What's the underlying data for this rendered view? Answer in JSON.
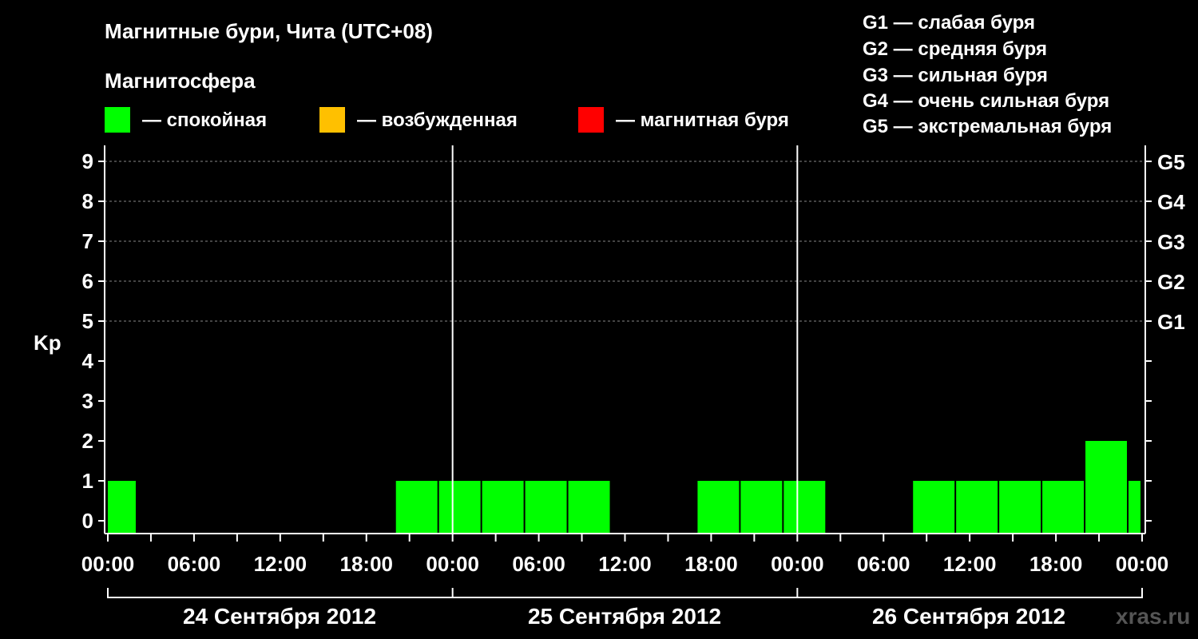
{
  "title": "Магнитные бури, Чита (UTC+08)",
  "legend_heading": "Магнитосфера",
  "legend": [
    {
      "label": "— спокойная",
      "color": "#00ff00"
    },
    {
      "label": "— возбужденная",
      "color": "#ffc000"
    },
    {
      "label": "— магнитная буря",
      "color": "#ff0000"
    }
  ],
  "g_legend": [
    "G1 — слабая буря",
    "G2 — средняя буря",
    "G3 — сильная буря",
    "G4 — очень сильная буря",
    "G5 — экстремальная буря"
  ],
  "watermark": "xras.ru",
  "chart_data": {
    "type": "bar",
    "ylabel": "Kp",
    "ylim": [
      0,
      9
    ],
    "yticks": [
      "0",
      "1",
      "2",
      "3",
      "4",
      "5",
      "6",
      "7",
      "8",
      "9"
    ],
    "right_ticks": [
      {
        "value": 5,
        "label": "G1"
      },
      {
        "value": 6,
        "label": "G2"
      },
      {
        "value": 7,
        "label": "G3"
      },
      {
        "value": 8,
        "label": "G4"
      },
      {
        "value": 9,
        "label": "G5"
      }
    ],
    "x_unit": "hours",
    "xlim": [
      0,
      72
    ],
    "xticks": [
      {
        "hour": 0,
        "label": "00:00"
      },
      {
        "hour": 6,
        "label": "06:00"
      },
      {
        "hour": 12,
        "label": "12:00"
      },
      {
        "hour": 18,
        "label": "18:00"
      },
      {
        "hour": 24,
        "label": "00:00"
      },
      {
        "hour": 30,
        "label": "06:00"
      },
      {
        "hour": 36,
        "label": "12:00"
      },
      {
        "hour": 42,
        "label": "18:00"
      },
      {
        "hour": 48,
        "label": "00:00"
      },
      {
        "hour": 54,
        "label": "06:00"
      },
      {
        "hour": 60,
        "label": "12:00"
      },
      {
        "hour": 66,
        "label": "18:00"
      },
      {
        "hour": 72,
        "label": "00:00"
      }
    ],
    "dates": [
      "24 Сентября 2012",
      "25 Сентября 2012",
      "26 Сентября 2012"
    ],
    "grid": true,
    "bars": [
      {
        "start": -1,
        "end": 2,
        "value": 1,
        "color": "#00ff00"
      },
      {
        "start": 2,
        "end": 5,
        "value": 0,
        "color": "#00ff00"
      },
      {
        "start": 5,
        "end": 8,
        "value": 0,
        "color": "#00ff00"
      },
      {
        "start": 8,
        "end": 11,
        "value": 0,
        "color": "#00ff00"
      },
      {
        "start": 11,
        "end": 14,
        "value": 0,
        "color": "#00ff00"
      },
      {
        "start": 14,
        "end": 17,
        "value": 0,
        "color": "#00ff00"
      },
      {
        "start": 17,
        "end": 20,
        "value": 0,
        "color": "#00ff00"
      },
      {
        "start": 20,
        "end": 23,
        "value": 1,
        "color": "#00ff00"
      },
      {
        "start": 23,
        "end": 26,
        "value": 1,
        "color": "#00ff00"
      },
      {
        "start": 26,
        "end": 29,
        "value": 1,
        "color": "#00ff00"
      },
      {
        "start": 29,
        "end": 32,
        "value": 1,
        "color": "#00ff00"
      },
      {
        "start": 32,
        "end": 35,
        "value": 1,
        "color": "#00ff00"
      },
      {
        "start": 35,
        "end": 38,
        "value": 0,
        "color": "#00ff00"
      },
      {
        "start": 38,
        "end": 41,
        "value": 0,
        "color": "#00ff00"
      },
      {
        "start": 41,
        "end": 44,
        "value": 1,
        "color": "#00ff00"
      },
      {
        "start": 44,
        "end": 47,
        "value": 1,
        "color": "#00ff00"
      },
      {
        "start": 47,
        "end": 50,
        "value": 1,
        "color": "#00ff00"
      },
      {
        "start": 50,
        "end": 53,
        "value": 0,
        "color": "#00ff00"
      },
      {
        "start": 53,
        "end": 56,
        "value": 0,
        "color": "#00ff00"
      },
      {
        "start": 56,
        "end": 59,
        "value": 1,
        "color": "#00ff00"
      },
      {
        "start": 59,
        "end": 62,
        "value": 1,
        "color": "#00ff00"
      },
      {
        "start": 62,
        "end": 65,
        "value": 1,
        "color": "#00ff00"
      },
      {
        "start": 65,
        "end": 68,
        "value": 1,
        "color": "#00ff00"
      },
      {
        "start": 68,
        "end": 71,
        "value": 2,
        "color": "#00ff00"
      },
      {
        "start": 71,
        "end": 74,
        "value": 1,
        "color": "#00ff00"
      }
    ]
  }
}
